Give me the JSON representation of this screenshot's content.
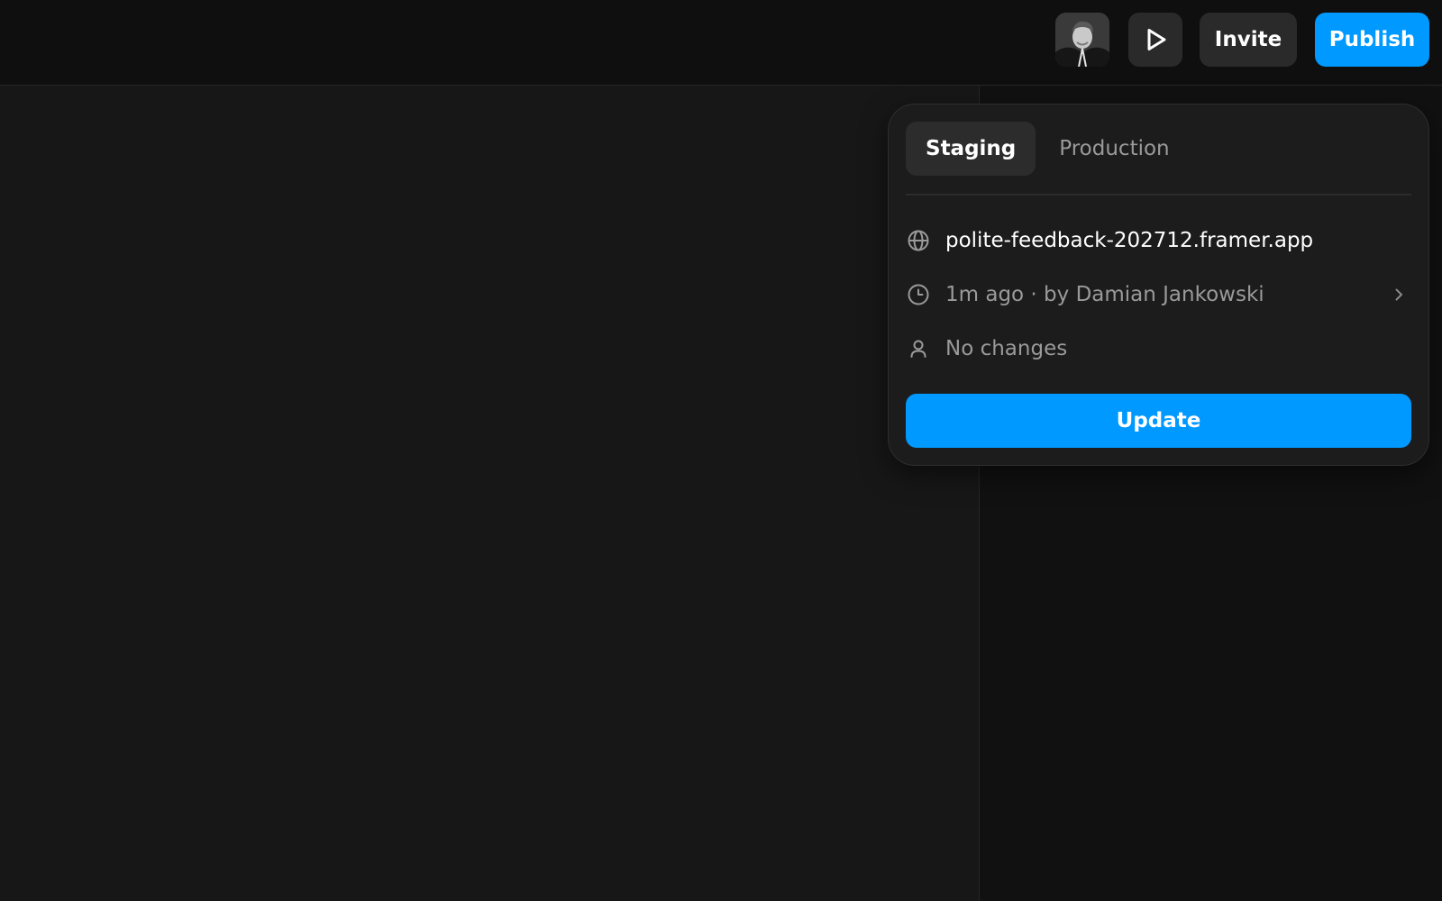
{
  "colors": {
    "accent": "#0099ff",
    "background": "#171717",
    "topbar": "#0f0f0f",
    "panel": "#1c1c1c"
  },
  "toolbar": {
    "avatar_icon": "user-avatar",
    "preview_icon": "play-icon",
    "invite_label": "Invite",
    "publish_label": "Publish"
  },
  "popover": {
    "tabs": [
      {
        "label": "Staging",
        "active": true
      },
      {
        "label": "Production",
        "active": false
      }
    ],
    "rows": [
      {
        "icon": "globe-icon",
        "text": "polite-feedback-202712.framer.app"
      },
      {
        "icon": "clock-icon",
        "text": "1m ago · by Damian Jankowski",
        "chevron_icon": "chevron-right-icon"
      },
      {
        "icon": "user-icon",
        "text": "No changes"
      }
    ],
    "update_label": "Update"
  }
}
